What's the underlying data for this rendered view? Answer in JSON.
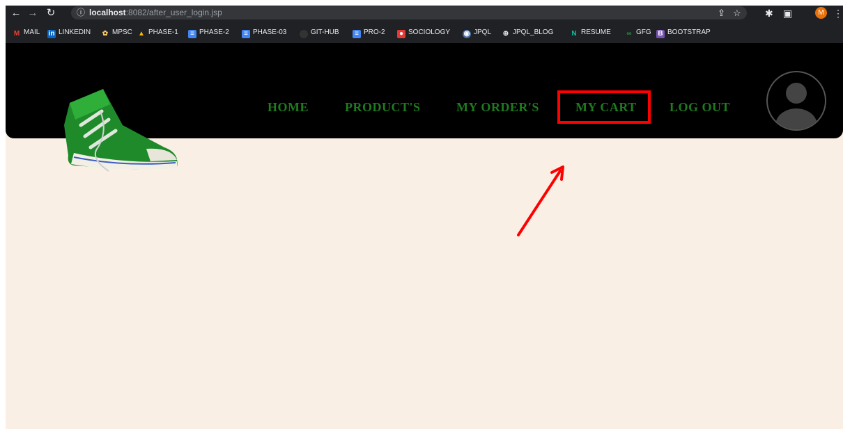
{
  "browser": {
    "back_icon": "back-arrow-icon",
    "forward_icon": "forward-arrow-icon",
    "reload_icon": "reload-icon",
    "info_glyph": "ⓘ",
    "url_host": "localhost",
    "url_rest": ":8082/after_user_login.jsp",
    "profile_initial": "M",
    "bookmarks": [
      "MAIL",
      "LINKEDIN",
      "MPSC",
      "PHASE-1",
      "PHASE-2",
      "PHASE-03",
      "GIT-HUB",
      "PRO-2",
      "SOCIOLOGY",
      "JPQL",
      "JPQL_BLOG",
      "RESUME",
      "GFG",
      "BOOTSTRAP"
    ]
  },
  "navbar": {
    "links": [
      "HOME",
      "PRODUCT'S",
      "MY ORDER'S",
      "MY CART",
      "LOG OUT"
    ],
    "brand_color": "#1e7b1e",
    "highlight_color": "#ff0000",
    "highlighted_item": "MY CART"
  }
}
